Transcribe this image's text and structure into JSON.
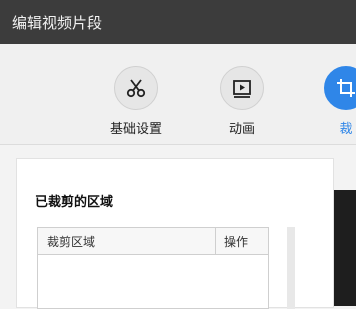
{
  "window": {
    "title": "编辑视频片段"
  },
  "toolbar": {
    "items": [
      {
        "label": "基础设置",
        "icon": "scissors-icon"
      },
      {
        "label": "动画",
        "icon": "animation-icon"
      },
      {
        "label": "裁",
        "icon": "crop-icon",
        "active": true
      }
    ]
  },
  "panel": {
    "heading": "已裁剪的区域",
    "table": {
      "columns": [
        "裁剪区域",
        "操作"
      ]
    }
  },
  "colors": {
    "titlebar": "#3c3c3c",
    "accent": "#2f86e8"
  }
}
